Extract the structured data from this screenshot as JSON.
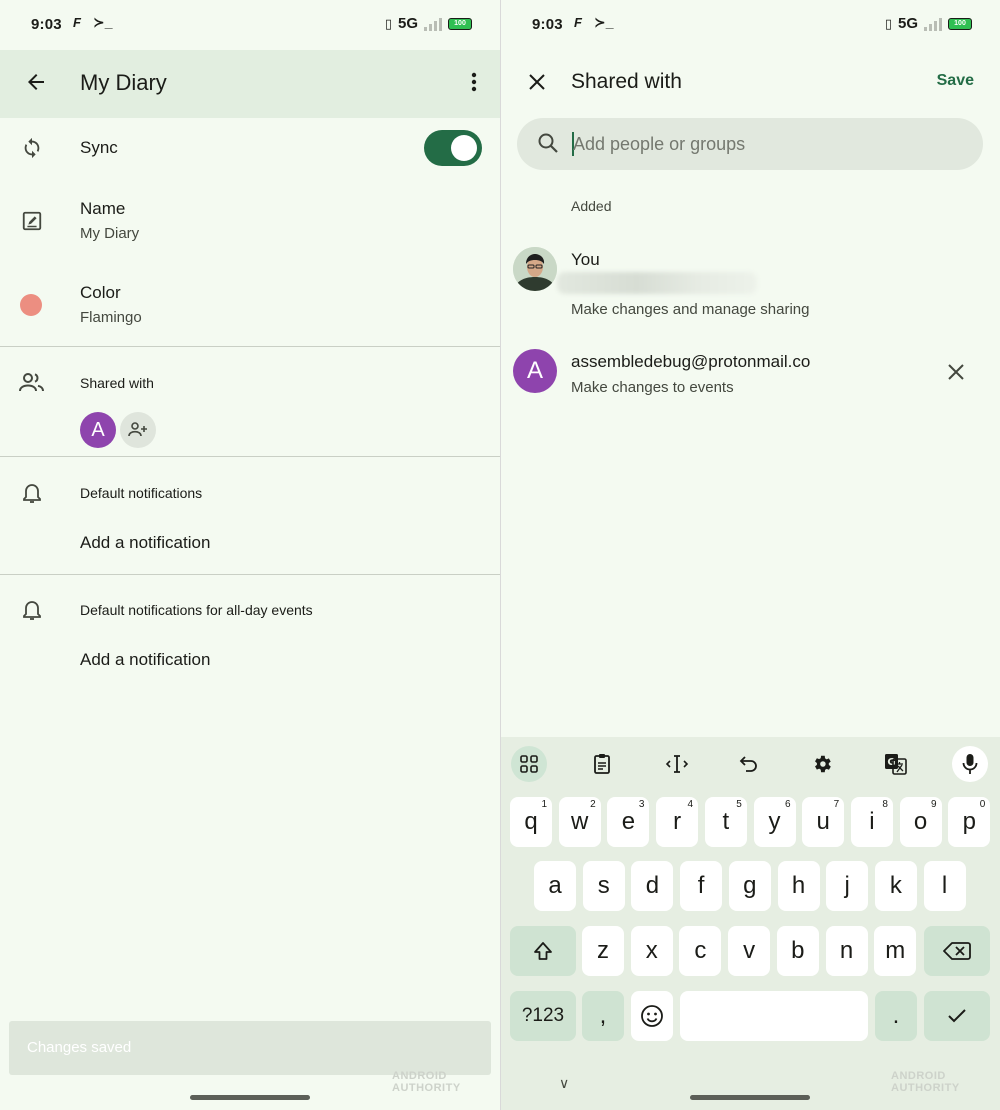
{
  "status_bar": {
    "time": "9:03",
    "app_icon_f": "F",
    "app_icon_term": "≻_",
    "network": "5G",
    "battery": "100"
  },
  "left": {
    "title": "My Diary",
    "sync": {
      "label": "Sync",
      "enabled": true
    },
    "name": {
      "label": "Name",
      "value": "My Diary"
    },
    "color": {
      "label": "Color",
      "value": "Flamingo",
      "swatch": "#ec8e81"
    },
    "shared_with": {
      "label": "Shared with",
      "avatar_letter": "A"
    },
    "default_notifications": {
      "label": "Default notifications",
      "action": "Add a notification"
    },
    "allday_notifications": {
      "label": "Default notifications for all-day events",
      "action": "Add a notification"
    },
    "snackbar": "Changes saved",
    "watermark": "ANDROID AUTHORITY"
  },
  "right": {
    "title": "Shared with",
    "save_label": "Save",
    "search_placeholder": "Add people or groups",
    "added_label": "Added",
    "owner": {
      "name": "You",
      "role": "Make changes and manage sharing"
    },
    "member": {
      "email": "assembledebug@protonmail.co",
      "role": "Make changes to events",
      "avatar_letter": "A",
      "avatar_color": "#8e44ad"
    },
    "keyboard": {
      "row1": [
        {
          "k": "q",
          "h": "1"
        },
        {
          "k": "w",
          "h": "2"
        },
        {
          "k": "e",
          "h": "3"
        },
        {
          "k": "r",
          "h": "4"
        },
        {
          "k": "t",
          "h": "5"
        },
        {
          "k": "y",
          "h": "6"
        },
        {
          "k": "u",
          "h": "7"
        },
        {
          "k": "i",
          "h": "8"
        },
        {
          "k": "o",
          "h": "9"
        },
        {
          "k": "p",
          "h": "0"
        }
      ],
      "row2": [
        "a",
        "s",
        "d",
        "f",
        "g",
        "h",
        "j",
        "k",
        "l"
      ],
      "row3": [
        "z",
        "x",
        "c",
        "v",
        "b",
        "n",
        "m"
      ],
      "symbols_key": "?123",
      "comma_key": ",",
      "period_key": ".",
      "emoji_key": "☺"
    },
    "watermark": "ANDROID AUTHORITY"
  },
  "colors": {
    "accent": "#236c46",
    "surface": "#f4faf1",
    "header": "#e2eee0"
  }
}
